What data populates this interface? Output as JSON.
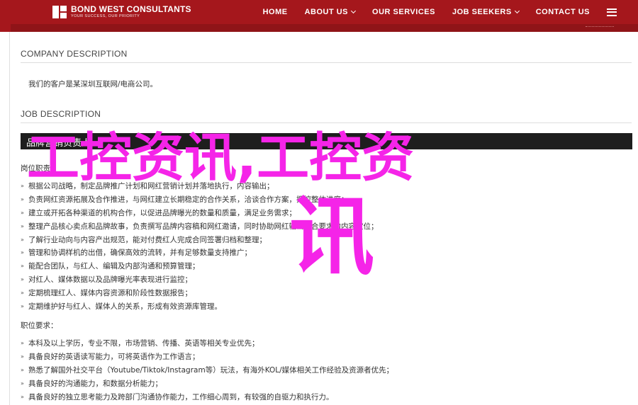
{
  "header": {
    "logo_name": "BOND WEST CONSULTANTS",
    "logo_tagline": "YOUR SUCCESS, OUR PRIORITY",
    "nav": [
      {
        "label": "HOME",
        "dropdown": false
      },
      {
        "label": "ABOUT US",
        "dropdown": true
      },
      {
        "label": "OUR SERVICES",
        "dropdown": false
      },
      {
        "label": "JOB SEEKERS",
        "dropdown": true
      },
      {
        "label": "CONTACT US",
        "dropdown": false
      }
    ],
    "menu_icon": "hamburger-icon",
    "brand_color": "#a5171c"
  },
  "company": {
    "title": "COMPANY DESCRIPTION",
    "text": "我们的客户是某深圳互联网/电商公司。"
  },
  "job": {
    "title": "JOB DESCRIPTION",
    "position_title": "品牌营销负责人",
    "duties_label": "岗位职责：",
    "duties": [
      "根据公司战略，制定品牌推广计划和网红营销计划并落地执行，内容输出；",
      "负责网红资源拓展及合作推进，与网红建立长期稳定的合作关系，洽谈合作方案，把控整体进度；",
      "建立或开拓各种渠道的机构合作，以促进品牌曝光的数量和质量，满足业务需求；",
      "整理产品核心卖点和品牌故事，负责撰写品牌内容稿和网红邀请，同时协助网红输出符合要求的内容定位；",
      "了解行业动向与内容产出规范，能对付费红人完成合同签署归档和整理；",
      "管理和协调样机的出借，确保高效的流转，并有足够数量支持推广；",
      "能配合团队，与红人、编辑及内部沟通和预算管理；",
      "对红人、媒体数据以及品牌曝光率表现进行监控；",
      "定期梳理红人、媒体内容资源和阶段性数据报告；",
      "定期维护好与红人、媒体人的关系，形成有效资源库管理。"
    ],
    "requirements_label": "职位要求：",
    "requirements": [
      "本科及以上学历，专业不限，市场营销、传播、英语等相关专业优先；",
      "具备良好的英语读写能力，可将英语作为工作语言；",
      "熟悉了解国外社交平台（Youtube/Tiktok/Instagram等）玩法，有海外KOL/媒体相关工作经验及资源者优先；",
      "具备良好的沟通能力，和数据分析能力；",
      "具备良好的独立思考能力及跨部门沟通协作能力，工作细心周到，有较强的自驱力和执行力。"
    ]
  },
  "watermark": {
    "line1": "工控资讯,工控资",
    "line2": "讯",
    "color": "#f524e8"
  }
}
